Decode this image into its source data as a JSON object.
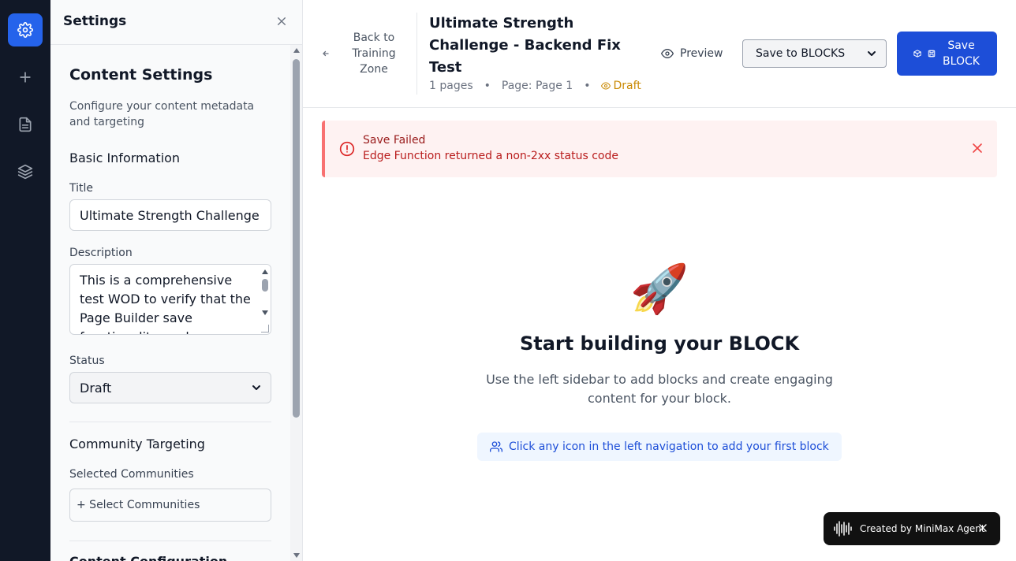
{
  "sidebar_panel": {
    "title": "Settings",
    "section_title": "Content Settings",
    "section_desc": "Configure your content metadata and targeting",
    "basic_info": "Basic Information",
    "title_label": "Title",
    "title_value": "Ultimate Strength Challenge",
    "description_label": "Description",
    "description_value": "This is a comprehensive test WOD to verify that the Page Builder save functionality works",
    "status_label": "Status",
    "status_value": "Draft",
    "community_targeting": "Community Targeting",
    "selected_communities_label": "Selected Communities",
    "select_communities_btn": "+ Select Communities",
    "content_configuration": "Content Configuration"
  },
  "header": {
    "back_label": "Back to Training Zone",
    "doc_title": "Ultimate Strength Challenge - Backend Fix Test",
    "pages_count": "1 pages",
    "page_label": "Page: Page 1",
    "status": "Draft",
    "preview_label": "Preview",
    "save_target": "Save to BLOCKS",
    "save_button": "Save BLOCK"
  },
  "alert": {
    "title": "Save Failed",
    "message": "Edge Function returned a non-2xx status code"
  },
  "empty_state": {
    "emoji": "🚀",
    "title": "Start building your BLOCK",
    "subtitle": "Use the left sidebar to add blocks and create engaging content for your block.",
    "hint": "Click any icon in the left navigation to add your first block"
  },
  "badge": {
    "text": "Created by MiniMax Agent"
  },
  "colors": {
    "rail_bg": "#111827",
    "accent": "#2563eb",
    "primary_button": "#1d4ed8",
    "alert_bg": "#fef2f2",
    "alert_border": "#f87171",
    "draft": "#ca8a04"
  }
}
